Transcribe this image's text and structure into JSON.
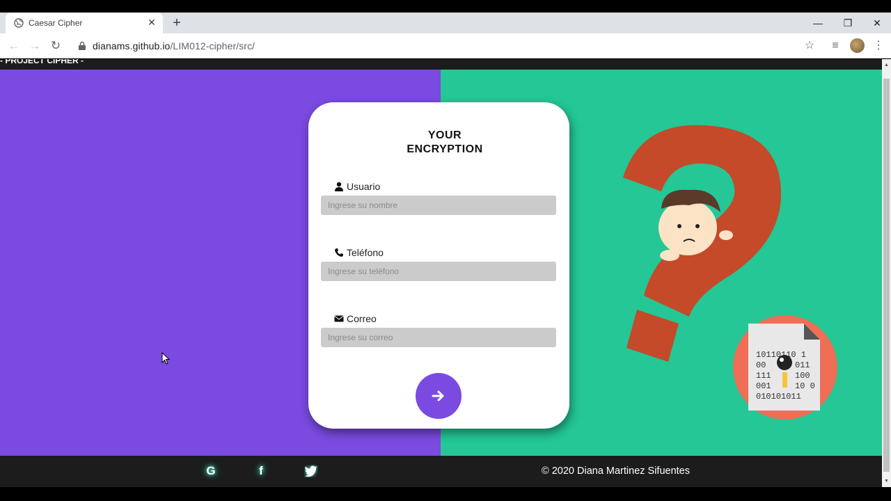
{
  "browser": {
    "tab_title": "Caesar Cipher",
    "tab_close": "✕",
    "new_tab": "+",
    "url_host": "dianams.github.io",
    "url_path": "/LIM012-cipher/src/",
    "window_controls": {
      "minimize": "—",
      "restore": "❐",
      "close": "✕"
    }
  },
  "page": {
    "header_label": "- PROJECT CIPHER -",
    "card": {
      "title_line1": "YOUR",
      "title_line2": "ENCRYPTION",
      "fields": [
        {
          "label": "Usuario",
          "placeholder": "Ingrese su nombre",
          "icon": "user-icon"
        },
        {
          "label": "Teléfono",
          "placeholder": "Ingrese su teléfono",
          "icon": "phone-icon"
        },
        {
          "label": "Correo",
          "placeholder": "Ingrese su correo",
          "icon": "envelope-icon"
        }
      ],
      "submit_icon": "arrow-right-icon"
    },
    "illustration": {
      "binary_lines": [
        "10110110 1",
        "00",
        "011",
        "111",
        "100",
        "001",
        "10 0",
        "010101011"
      ]
    },
    "footer": {
      "social": [
        {
          "name": "google-icon",
          "glyph": "G"
        },
        {
          "name": "facebook-icon",
          "glyph": "f"
        },
        {
          "name": "twitter-icon",
          "glyph": "🐦"
        }
      ],
      "copyright": "© 2020 Diana Martinez Sifuentes"
    }
  },
  "colors": {
    "purple": "#7b4ae0",
    "green": "#24c795",
    "dark": "#1c1c1c",
    "input_bg": "#cbcbcb",
    "question_mark": "#c44a2a",
    "doc_circle": "#ee6e56"
  }
}
